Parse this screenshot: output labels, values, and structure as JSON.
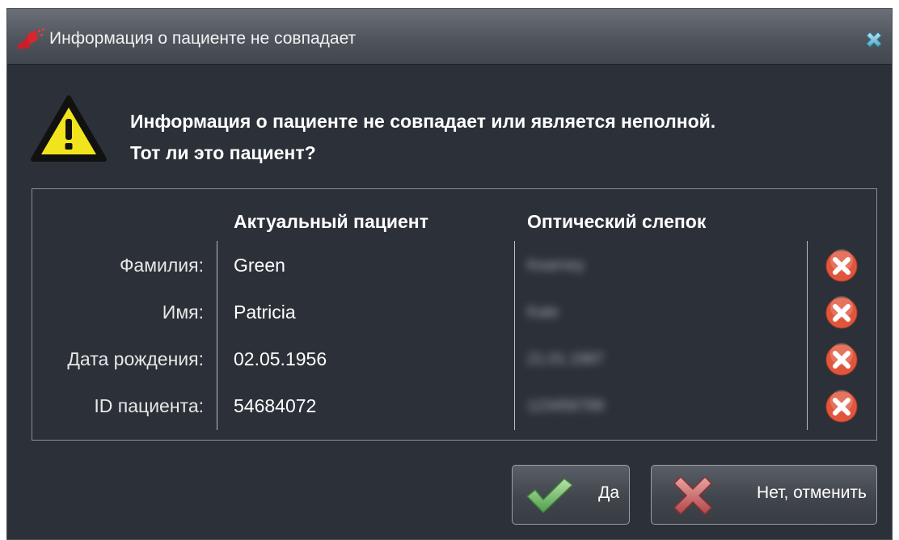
{
  "window": {
    "title": "Информация о пациенте не совпадает",
    "app_icon": "app-logo-icon",
    "close_icon": "close-icon"
  },
  "message": {
    "icon": "warning-icon",
    "line1": "Информация о пациенте не совпадает или является неполной.",
    "line2": "Тот ли это пациент?"
  },
  "table": {
    "headers": {
      "current": "Актуальный пациент",
      "optical": "Оптический слепок"
    },
    "rows": [
      {
        "label": "Фамилия:",
        "current": "Green",
        "optical": "Kearney",
        "status_icon": "mismatch-icon"
      },
      {
        "label": "Имя:",
        "current": "Patricia",
        "optical": "Kate",
        "status_icon": "mismatch-icon"
      },
      {
        "label": "Дата рождения:",
        "current": "02.05.1956",
        "optical": "21.01.1987",
        "status_icon": "mismatch-icon"
      },
      {
        "label": "ID пациента:",
        "current": "54684072",
        "optical": "123456789",
        "status_icon": "mismatch-icon"
      }
    ]
  },
  "buttons": {
    "yes": {
      "label": "Да",
      "icon": "checkmark-icon"
    },
    "no": {
      "label": "Нет, отменить",
      "icon": "cross-icon"
    }
  },
  "colors": {
    "background": "#2c3139",
    "warning_yellow": "#f5e21a",
    "error_red": "#e0563c",
    "check_green": "#7cc576"
  }
}
